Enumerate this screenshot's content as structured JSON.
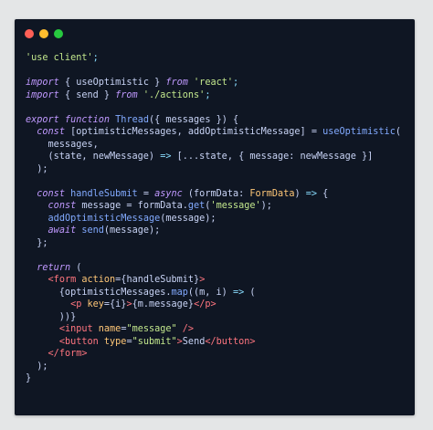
{
  "window": {
    "traffic_lights": [
      {
        "name": "close",
        "color": "#ff5f56"
      },
      {
        "name": "minimize",
        "color": "#ffbd2e"
      },
      {
        "name": "maximize",
        "color": "#27c93f"
      }
    ]
  },
  "code": {
    "language": "tsx",
    "lines": [
      [
        {
          "t": "'use client'",
          "c": "string"
        },
        {
          "t": ";",
          "c": "punct"
        }
      ],
      [],
      [
        {
          "t": "import",
          "c": "keyword"
        },
        {
          "t": " { useOptimistic } ",
          "c": "plain"
        },
        {
          "t": "from",
          "c": "keyword"
        },
        {
          "t": " ",
          "c": "plain"
        },
        {
          "t": "'react'",
          "c": "string"
        },
        {
          "t": ";",
          "c": "punct"
        }
      ],
      [
        {
          "t": "import",
          "c": "keyword"
        },
        {
          "t": " { send } ",
          "c": "plain"
        },
        {
          "t": "from",
          "c": "keyword"
        },
        {
          "t": " ",
          "c": "plain"
        },
        {
          "t": "'./actions'",
          "c": "string"
        },
        {
          "t": ";",
          "c": "punct"
        }
      ],
      [],
      [
        {
          "t": "export",
          "c": "keyword"
        },
        {
          "t": " ",
          "c": "plain"
        },
        {
          "t": "function",
          "c": "keyword"
        },
        {
          "t": " ",
          "c": "plain"
        },
        {
          "t": "Thread",
          "c": "function"
        },
        {
          "t": "({ messages }) {",
          "c": "plain"
        }
      ],
      [
        {
          "t": "  ",
          "c": "plain"
        },
        {
          "t": "const",
          "c": "keyword"
        },
        {
          "t": " [optimisticMessages, addOptimisticMessage] = ",
          "c": "plain"
        },
        {
          "t": "useOptimistic",
          "c": "function"
        },
        {
          "t": "(",
          "c": "plain"
        }
      ],
      [
        {
          "t": "    messages,",
          "c": "plain"
        }
      ],
      [
        {
          "t": "    (state, newMessage) ",
          "c": "plain"
        },
        {
          "t": "=>",
          "c": "punct"
        },
        {
          "t": " [...state, { message: newMessage }]",
          "c": "plain"
        }
      ],
      [
        {
          "t": "  );",
          "c": "plain"
        }
      ],
      [],
      [
        {
          "t": "  ",
          "c": "plain"
        },
        {
          "t": "const",
          "c": "keyword"
        },
        {
          "t": " ",
          "c": "plain"
        },
        {
          "t": "handleSubmit",
          "c": "function"
        },
        {
          "t": " = ",
          "c": "plain"
        },
        {
          "t": "async",
          "c": "keyword"
        },
        {
          "t": " (formData: ",
          "c": "plain"
        },
        {
          "t": "FormData",
          "c": "type"
        },
        {
          "t": ") ",
          "c": "plain"
        },
        {
          "t": "=>",
          "c": "punct"
        },
        {
          "t": " {",
          "c": "plain"
        }
      ],
      [
        {
          "t": "    ",
          "c": "plain"
        },
        {
          "t": "const",
          "c": "keyword"
        },
        {
          "t": " message = formData.",
          "c": "plain"
        },
        {
          "t": "get",
          "c": "function"
        },
        {
          "t": "(",
          "c": "plain"
        },
        {
          "t": "'message'",
          "c": "string"
        },
        {
          "t": ");",
          "c": "plain"
        }
      ],
      [
        {
          "t": "    ",
          "c": "plain"
        },
        {
          "t": "addOptimisticMessage",
          "c": "function"
        },
        {
          "t": "(message);",
          "c": "plain"
        }
      ],
      [
        {
          "t": "    ",
          "c": "plain"
        },
        {
          "t": "await",
          "c": "keyword"
        },
        {
          "t": " ",
          "c": "plain"
        },
        {
          "t": "send",
          "c": "function"
        },
        {
          "t": "(message);",
          "c": "plain"
        }
      ],
      [
        {
          "t": "  };",
          "c": "plain"
        }
      ],
      [],
      [
        {
          "t": "  ",
          "c": "plain"
        },
        {
          "t": "return",
          "c": "keyword"
        },
        {
          "t": " (",
          "c": "plain"
        }
      ],
      [
        {
          "t": "    ",
          "c": "plain"
        },
        {
          "t": "<form",
          "c": "tag"
        },
        {
          "t": " ",
          "c": "plain"
        },
        {
          "t": "action",
          "c": "attr"
        },
        {
          "t": "={handleSubmit}",
          "c": "plain"
        },
        {
          "t": ">",
          "c": "tag"
        }
      ],
      [
        {
          "t": "      {optimisticMessages.",
          "c": "plain"
        },
        {
          "t": "map",
          "c": "function"
        },
        {
          "t": "((m, i) ",
          "c": "plain"
        },
        {
          "t": "=>",
          "c": "punct"
        },
        {
          "t": " (",
          "c": "plain"
        }
      ],
      [
        {
          "t": "        ",
          "c": "plain"
        },
        {
          "t": "<p",
          "c": "tag"
        },
        {
          "t": " ",
          "c": "plain"
        },
        {
          "t": "key",
          "c": "attr"
        },
        {
          "t": "={i}",
          "c": "plain"
        },
        {
          "t": ">",
          "c": "tag"
        },
        {
          "t": "{m.message}",
          "c": "plain"
        },
        {
          "t": "</p>",
          "c": "tag"
        }
      ],
      [
        {
          "t": "      ))}",
          "c": "plain"
        }
      ],
      [
        {
          "t": "      ",
          "c": "plain"
        },
        {
          "t": "<input",
          "c": "tag"
        },
        {
          "t": " ",
          "c": "plain"
        },
        {
          "t": "name",
          "c": "attr"
        },
        {
          "t": "=",
          "c": "plain"
        },
        {
          "t": "\"message\"",
          "c": "string"
        },
        {
          "t": " />",
          "c": "tag"
        }
      ],
      [
        {
          "t": "      ",
          "c": "plain"
        },
        {
          "t": "<button",
          "c": "tag"
        },
        {
          "t": " ",
          "c": "plain"
        },
        {
          "t": "type",
          "c": "attr"
        },
        {
          "t": "=",
          "c": "plain"
        },
        {
          "t": "\"submit\"",
          "c": "string"
        },
        {
          "t": ">",
          "c": "tag"
        },
        {
          "t": "Send",
          "c": "plain"
        },
        {
          "t": "</button>",
          "c": "tag"
        }
      ],
      [
        {
          "t": "    ",
          "c": "plain"
        },
        {
          "t": "</form>",
          "c": "tag"
        }
      ],
      [
        {
          "t": "  );",
          "c": "plain"
        }
      ],
      [
        {
          "t": "}",
          "c": "plain"
        }
      ]
    ]
  }
}
